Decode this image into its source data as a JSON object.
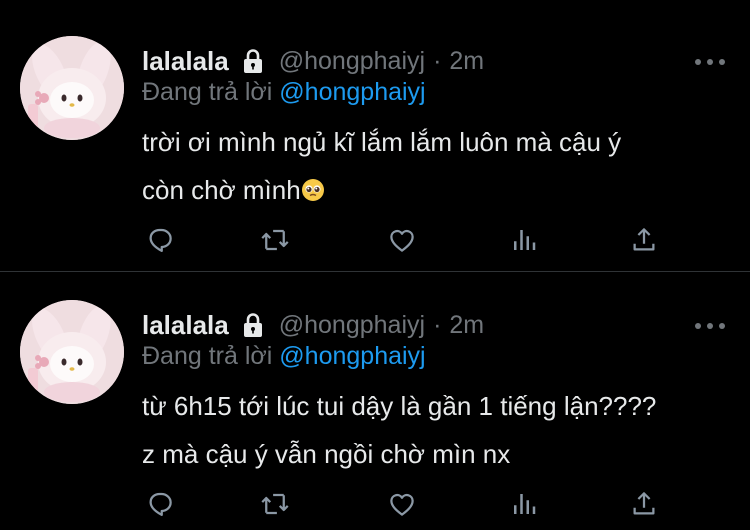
{
  "colors": {
    "background": "#000000",
    "text": "#e7e9ea",
    "muted": "#71767b",
    "accent": "#1d9bf0",
    "divider": "#2f3336"
  },
  "tweets": [
    {
      "display_name": "lalalala",
      "handle": "@hongphaiyj",
      "separator": "·",
      "time": "2m",
      "reply_prefix": "Đang trả lời",
      "reply_to": "@hongphaiyj",
      "lines": [
        "trời ơi mình ngủ kĩ lắm lắm luôn mà cậu ý",
        "còn chờ mình"
      ],
      "trailing_emoji": "pleading-face-emoji"
    },
    {
      "display_name": "lalalala",
      "handle": "@hongphaiyj",
      "separator": "·",
      "time": "2m",
      "reply_prefix": "Đang trả lời",
      "reply_to": "@hongphaiyj",
      "lines": [
        "từ 6h15 tới lúc tui dậy là gần 1 tiếng lận????",
        "z mà cậu ý vẫn ngồi chờ mìn nx"
      ]
    }
  ],
  "icons": {
    "verified_lock": "lock-icon",
    "more": "more-icon",
    "actions": [
      "reply-icon",
      "retweet-icon",
      "like-icon",
      "views-icon",
      "share-icon"
    ]
  }
}
